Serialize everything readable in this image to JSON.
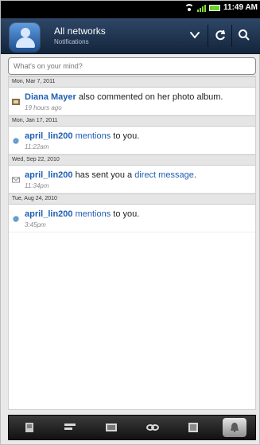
{
  "status": {
    "time": "11:49 AM"
  },
  "header": {
    "title": "All networks",
    "subtitle": "Notifications"
  },
  "compose": {
    "placeholder": "What's on your mind?"
  },
  "notifications": [
    {
      "date": "Mon, Mar 7, 2011",
      "user": "Diana Mayer",
      "text": " also commented on her photo album.",
      "link": "",
      "time": "19 hours ago",
      "icon": "album-icon"
    },
    {
      "date": "Mon, Jan 17, 2011",
      "user": "april_lin200",
      "text": "",
      "link": " mentions",
      "tail": " to you.",
      "time": "11:22am",
      "icon": "mention-icon"
    },
    {
      "date": "Wed, Sep 22, 2010",
      "user": "april_lin200",
      "text": " has sent you a ",
      "link": "direct message",
      "tail": ".",
      "time": "11:34pm",
      "icon": "message-icon"
    },
    {
      "date": "Tue, Aug 24, 2010",
      "user": "april_lin200",
      "text": "",
      "link": " mentions",
      "tail": " to you.",
      "time": "3:45pm",
      "icon": "mention-icon"
    }
  ],
  "toolbar": {
    "items": [
      {
        "name": "photos-tab",
        "icon": "photo-icon"
      },
      {
        "name": "updates-tab",
        "icon": "list-icon"
      },
      {
        "name": "albums-tab",
        "icon": "film-icon"
      },
      {
        "name": "links-tab",
        "icon": "link-icon"
      },
      {
        "name": "photos2-tab",
        "icon": "image-icon"
      },
      {
        "name": "notifications-tab",
        "icon": "bell-icon",
        "active": true
      }
    ]
  }
}
